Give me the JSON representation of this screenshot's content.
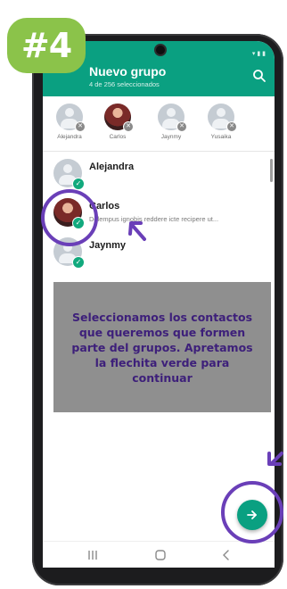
{
  "step_badge": "#4",
  "header": {
    "title": "Nuevo grupo",
    "subtitle": "4 de 256 seleccionados",
    "search_icon": "search-icon"
  },
  "selected_contacts": [
    {
      "name": "Alejandra",
      "photo": false
    },
    {
      "name": "Carlos",
      "photo": true
    },
    {
      "name": "Jaynmy",
      "photo": false
    },
    {
      "name": "Yusaika",
      "photo": false
    }
  ],
  "contacts": [
    {
      "name": "Alejandra",
      "status": "",
      "selected": true,
      "photo": false
    },
    {
      "name": "Carlos",
      "status": "Dolempus ignobis reddere icte recipere ut...",
      "selected": true,
      "photo": true
    },
    {
      "name": "Jaynmy",
      "status": "",
      "selected": true,
      "photo": false
    }
  ],
  "caption": "Seleccionamos los contactos que queremos que formen parte del grupos. Apretamos la flechita verde para continuar",
  "fab_icon": "arrow-right-icon",
  "nav_icons": [
    "recents-icon",
    "home-icon",
    "back-icon"
  ],
  "colors": {
    "accent": "#0aa081",
    "check": "#11a97d",
    "badge": "#8bc34a",
    "annotation": "#6a3fb8",
    "caption_text": "#3d1f7a"
  }
}
